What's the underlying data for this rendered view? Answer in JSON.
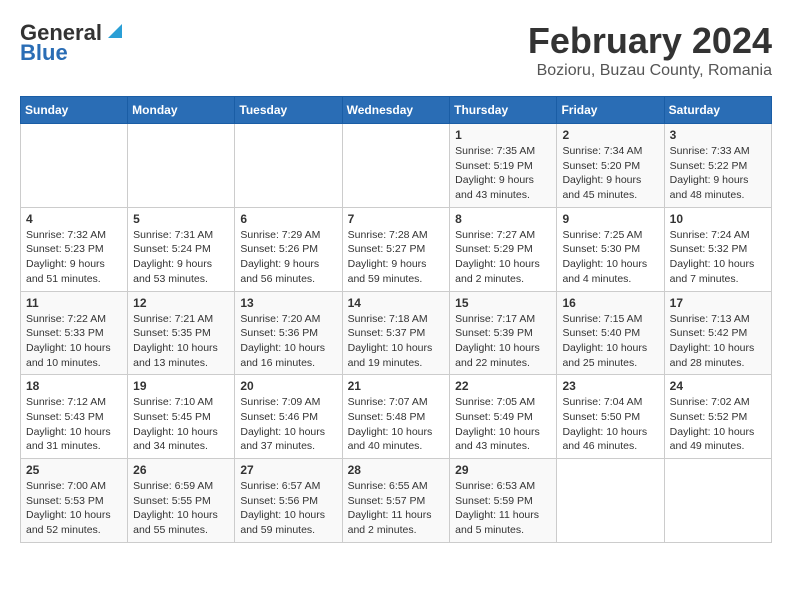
{
  "header": {
    "logo_line1": "General",
    "logo_line2": "Blue",
    "title": "February 2024",
    "subtitle": "Bozioru, Buzau County, Romania"
  },
  "calendar": {
    "weekdays": [
      "Sunday",
      "Monday",
      "Tuesday",
      "Wednesday",
      "Thursday",
      "Friday",
      "Saturday"
    ],
    "weeks": [
      [
        {
          "day": "",
          "info": ""
        },
        {
          "day": "",
          "info": ""
        },
        {
          "day": "",
          "info": ""
        },
        {
          "day": "",
          "info": ""
        },
        {
          "day": "1",
          "info": "Sunrise: 7:35 AM\nSunset: 5:19 PM\nDaylight: 9 hours and 43 minutes."
        },
        {
          "day": "2",
          "info": "Sunrise: 7:34 AM\nSunset: 5:20 PM\nDaylight: 9 hours and 45 minutes."
        },
        {
          "day": "3",
          "info": "Sunrise: 7:33 AM\nSunset: 5:22 PM\nDaylight: 9 hours and 48 minutes."
        }
      ],
      [
        {
          "day": "4",
          "info": "Sunrise: 7:32 AM\nSunset: 5:23 PM\nDaylight: 9 hours and 51 minutes."
        },
        {
          "day": "5",
          "info": "Sunrise: 7:31 AM\nSunset: 5:24 PM\nDaylight: 9 hours and 53 minutes."
        },
        {
          "day": "6",
          "info": "Sunrise: 7:29 AM\nSunset: 5:26 PM\nDaylight: 9 hours and 56 minutes."
        },
        {
          "day": "7",
          "info": "Sunrise: 7:28 AM\nSunset: 5:27 PM\nDaylight: 9 hours and 59 minutes."
        },
        {
          "day": "8",
          "info": "Sunrise: 7:27 AM\nSunset: 5:29 PM\nDaylight: 10 hours and 2 minutes."
        },
        {
          "day": "9",
          "info": "Sunrise: 7:25 AM\nSunset: 5:30 PM\nDaylight: 10 hours and 4 minutes."
        },
        {
          "day": "10",
          "info": "Sunrise: 7:24 AM\nSunset: 5:32 PM\nDaylight: 10 hours and 7 minutes."
        }
      ],
      [
        {
          "day": "11",
          "info": "Sunrise: 7:22 AM\nSunset: 5:33 PM\nDaylight: 10 hours and 10 minutes."
        },
        {
          "day": "12",
          "info": "Sunrise: 7:21 AM\nSunset: 5:35 PM\nDaylight: 10 hours and 13 minutes."
        },
        {
          "day": "13",
          "info": "Sunrise: 7:20 AM\nSunset: 5:36 PM\nDaylight: 10 hours and 16 minutes."
        },
        {
          "day": "14",
          "info": "Sunrise: 7:18 AM\nSunset: 5:37 PM\nDaylight: 10 hours and 19 minutes."
        },
        {
          "day": "15",
          "info": "Sunrise: 7:17 AM\nSunset: 5:39 PM\nDaylight: 10 hours and 22 minutes."
        },
        {
          "day": "16",
          "info": "Sunrise: 7:15 AM\nSunset: 5:40 PM\nDaylight: 10 hours and 25 minutes."
        },
        {
          "day": "17",
          "info": "Sunrise: 7:13 AM\nSunset: 5:42 PM\nDaylight: 10 hours and 28 minutes."
        }
      ],
      [
        {
          "day": "18",
          "info": "Sunrise: 7:12 AM\nSunset: 5:43 PM\nDaylight: 10 hours and 31 minutes."
        },
        {
          "day": "19",
          "info": "Sunrise: 7:10 AM\nSunset: 5:45 PM\nDaylight: 10 hours and 34 minutes."
        },
        {
          "day": "20",
          "info": "Sunrise: 7:09 AM\nSunset: 5:46 PM\nDaylight: 10 hours and 37 minutes."
        },
        {
          "day": "21",
          "info": "Sunrise: 7:07 AM\nSunset: 5:48 PM\nDaylight: 10 hours and 40 minutes."
        },
        {
          "day": "22",
          "info": "Sunrise: 7:05 AM\nSunset: 5:49 PM\nDaylight: 10 hours and 43 minutes."
        },
        {
          "day": "23",
          "info": "Sunrise: 7:04 AM\nSunset: 5:50 PM\nDaylight: 10 hours and 46 minutes."
        },
        {
          "day": "24",
          "info": "Sunrise: 7:02 AM\nSunset: 5:52 PM\nDaylight: 10 hours and 49 minutes."
        }
      ],
      [
        {
          "day": "25",
          "info": "Sunrise: 7:00 AM\nSunset: 5:53 PM\nDaylight: 10 hours and 52 minutes."
        },
        {
          "day": "26",
          "info": "Sunrise: 6:59 AM\nSunset: 5:55 PM\nDaylight: 10 hours and 55 minutes."
        },
        {
          "day": "27",
          "info": "Sunrise: 6:57 AM\nSunset: 5:56 PM\nDaylight: 10 hours and 59 minutes."
        },
        {
          "day": "28",
          "info": "Sunrise: 6:55 AM\nSunset: 5:57 PM\nDaylight: 11 hours and 2 minutes."
        },
        {
          "day": "29",
          "info": "Sunrise: 6:53 AM\nSunset: 5:59 PM\nDaylight: 11 hours and 5 minutes."
        },
        {
          "day": "",
          "info": ""
        },
        {
          "day": "",
          "info": ""
        }
      ]
    ]
  }
}
